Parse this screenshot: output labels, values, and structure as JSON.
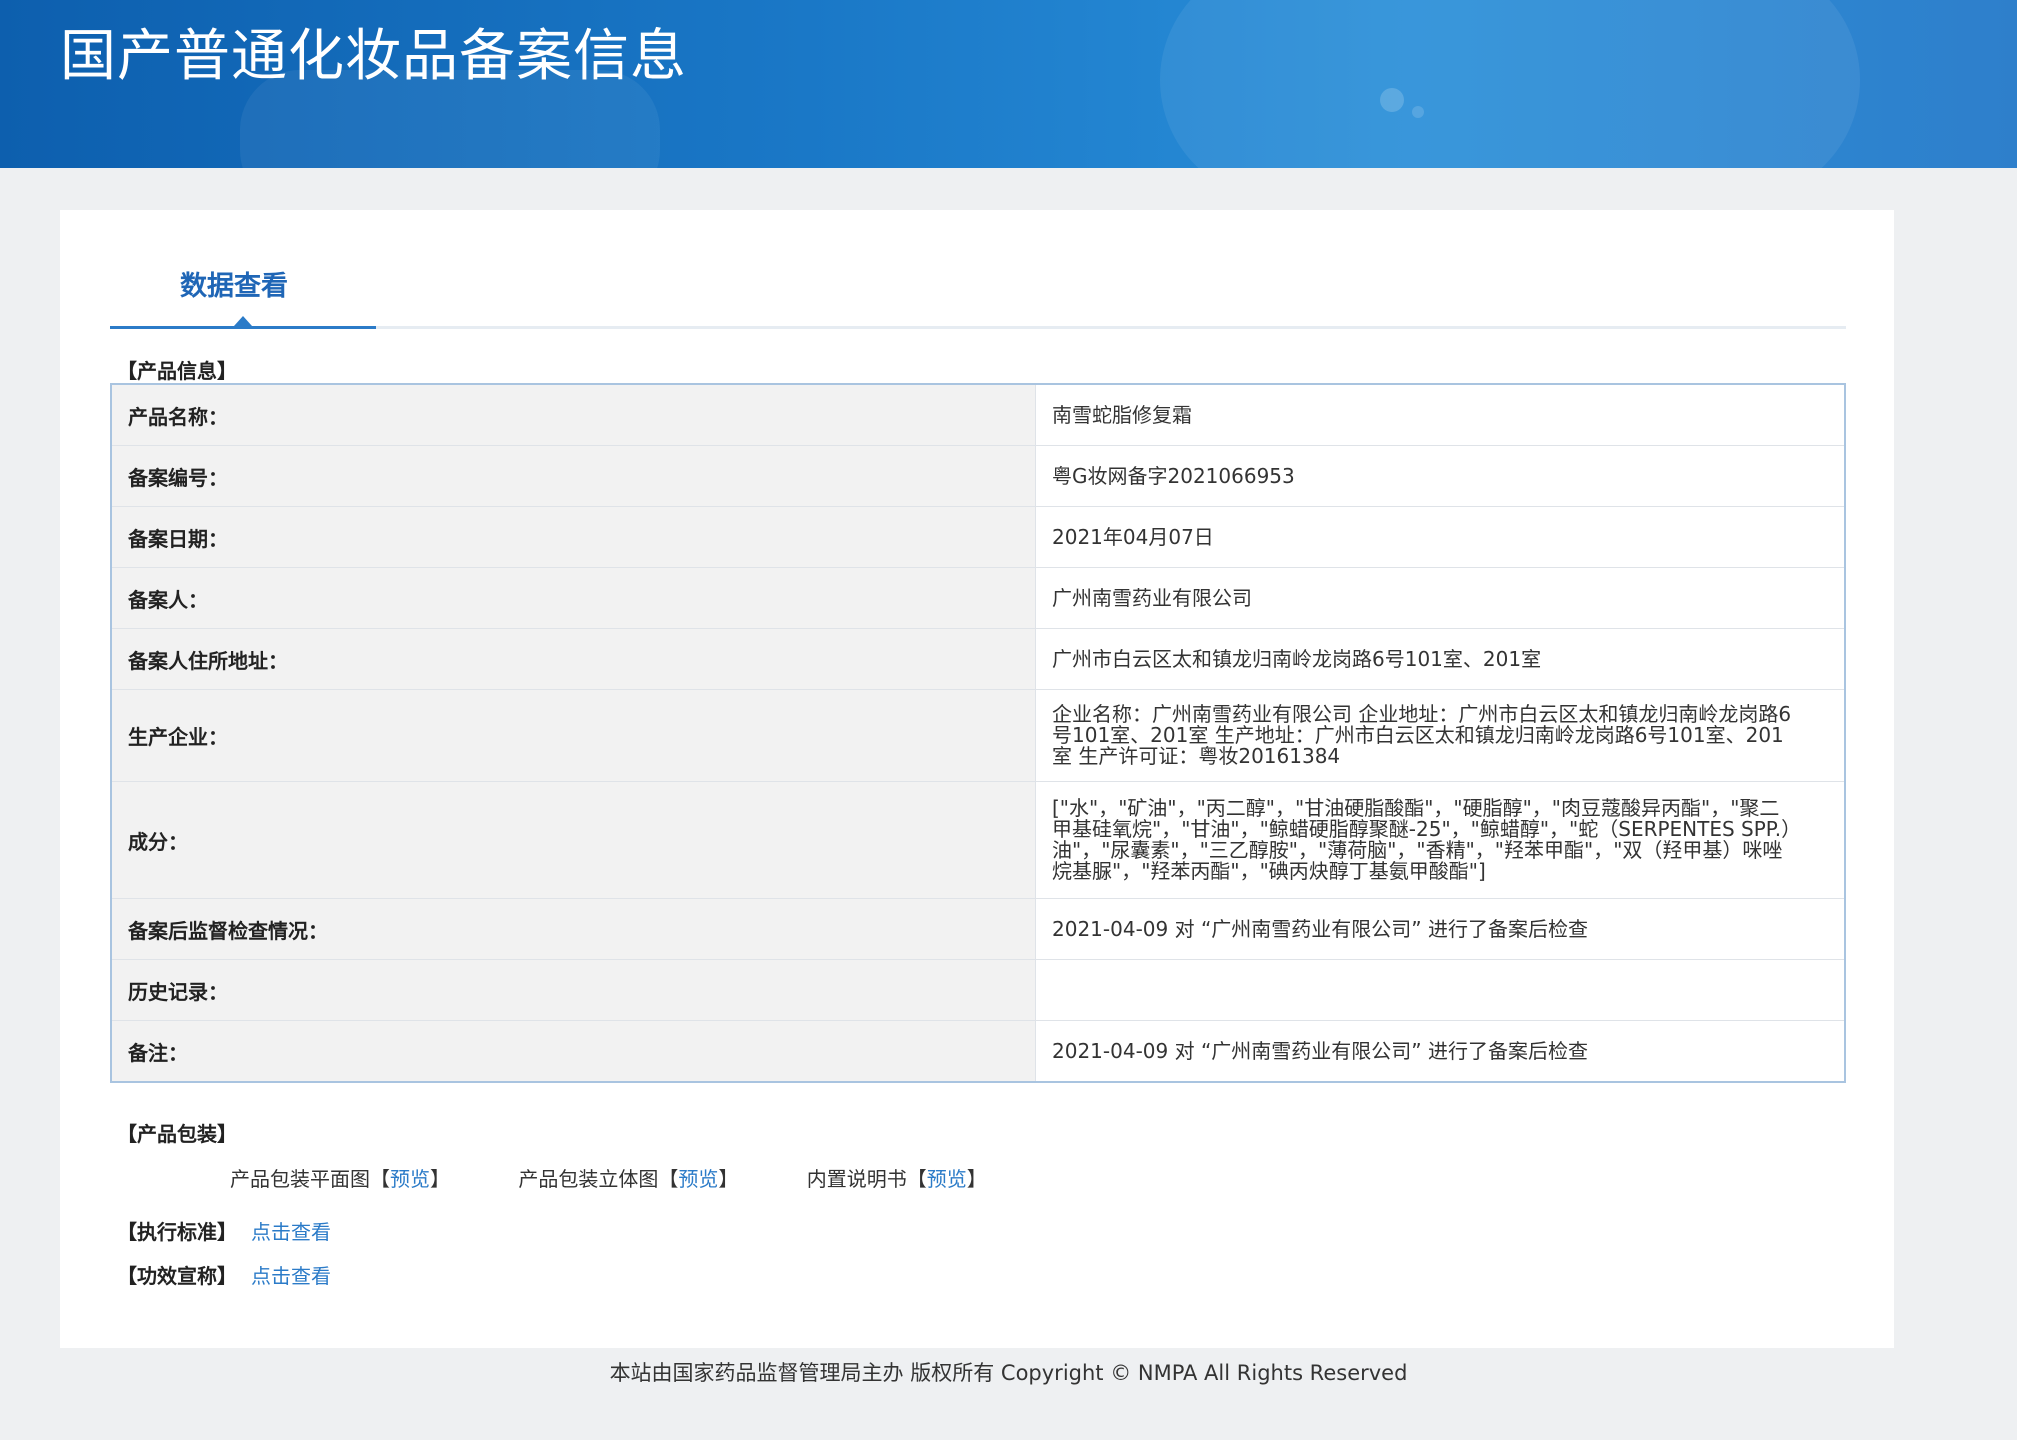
{
  "header": {
    "title": "国产普通化妆品备案信息"
  },
  "tabs": [
    {
      "label": "数据查看",
      "active": true
    }
  ],
  "product_info": {
    "section_title": "【产品信息】",
    "rows": [
      {
        "label": "产品名称：",
        "value": "南雪蛇脂修复霜"
      },
      {
        "label": "备案编号：",
        "value": "粤G妆网备字2021066953"
      },
      {
        "label": "备案日期：",
        "value": "2021年04月07日"
      },
      {
        "label": "备案人：",
        "value": "广州南雪药业有限公司"
      },
      {
        "label": "备案人住所地址：",
        "value": "广州市白云区太和镇龙归南岭龙岗路6号101室、201室"
      },
      {
        "label": "生产企业：",
        "value": "企业名称：广州南雪药业有限公司 企业地址：广州市白云区太和镇龙归南岭龙岗路6号101室、201室 生产地址：广州市白云区太和镇龙归南岭龙岗路6号101室、201室 生产许可证：粤妆20161384"
      },
      {
        "label": "成分：",
        "value": "[\"水\"，\"矿油\"，\"丙二醇\"，\"甘油硬脂酸酯\"，\"硬脂醇\"，\"肉豆蔻酸异丙酯\"，\"聚二甲基硅氧烷\"，\"甘油\"，\"鲸蜡硬脂醇聚醚-25\"，\"鲸蜡醇\"，\"蛇（SERPENTES SPP.）油\"，\"尿囊素\"，\"三乙醇胺\"，\"薄荷脑\"，\"香精\"，\"羟苯甲酯\"，\"双（羟甲基）咪唑烷基脲\"，\"羟苯丙酯\"，\"碘丙炔醇丁基氨甲酸酯\"]"
      },
      {
        "label": "备案后监督检查情况：",
        "value": "2021-04-09 对 “广州南雪药业有限公司” 进行了备案后检查"
      },
      {
        "label": "历史记录：",
        "value": ""
      },
      {
        "label": "备注：",
        "value": "2021-04-09 对 “广州南雪药业有限公司” 进行了备案后检查"
      }
    ]
  },
  "packaging": {
    "section_title": "【产品包装】",
    "items": [
      {
        "label": "产品包装平面图",
        "bracket_open": "【",
        "link": "预览",
        "bracket_close": "】"
      },
      {
        "label": "产品包装立体图",
        "bracket_open": "【",
        "link": "预览",
        "bracket_close": "】"
      },
      {
        "label": "内置说明书",
        "bracket_open": "【",
        "link": "预览",
        "bracket_close": "】"
      }
    ]
  },
  "standards": {
    "label": "【执行标准】",
    "link": "点击查看"
  },
  "efficacy": {
    "label": "【功效宣称】",
    "link": "点击查看"
  },
  "footer": {
    "text": "本站由国家药品监督管理局主办 版权所有 Copyright © NMPA All Rights Reserved"
  }
}
